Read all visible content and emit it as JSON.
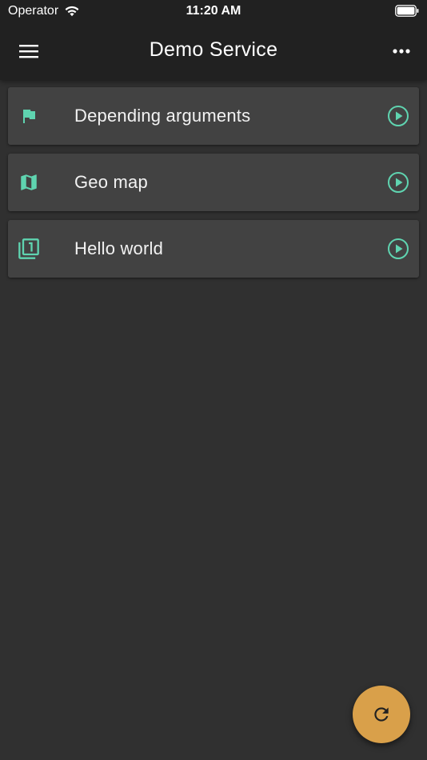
{
  "status_bar": {
    "carrier": "Operator",
    "time": "11:20 AM"
  },
  "app_bar": {
    "title": "Demo Service",
    "menu_icon": "hamburger-menu-icon",
    "more_icon": "more-horizontal-icon"
  },
  "services": [
    {
      "label": "Depending arguments",
      "icon": "flag-icon",
      "action_icon": "play-circle-icon"
    },
    {
      "label": "Geo map",
      "icon": "map-icon",
      "action_icon": "play-circle-icon"
    },
    {
      "label": "Hello world",
      "icon": "filter-1-icon",
      "action_icon": "play-circle-icon"
    }
  ],
  "fab": {
    "icon": "refresh-icon"
  },
  "colors": {
    "background": "#303030",
    "app_bar": "#212121",
    "card": "#424242",
    "accent": "#5fd4b0",
    "fab": "#d9a04a"
  }
}
